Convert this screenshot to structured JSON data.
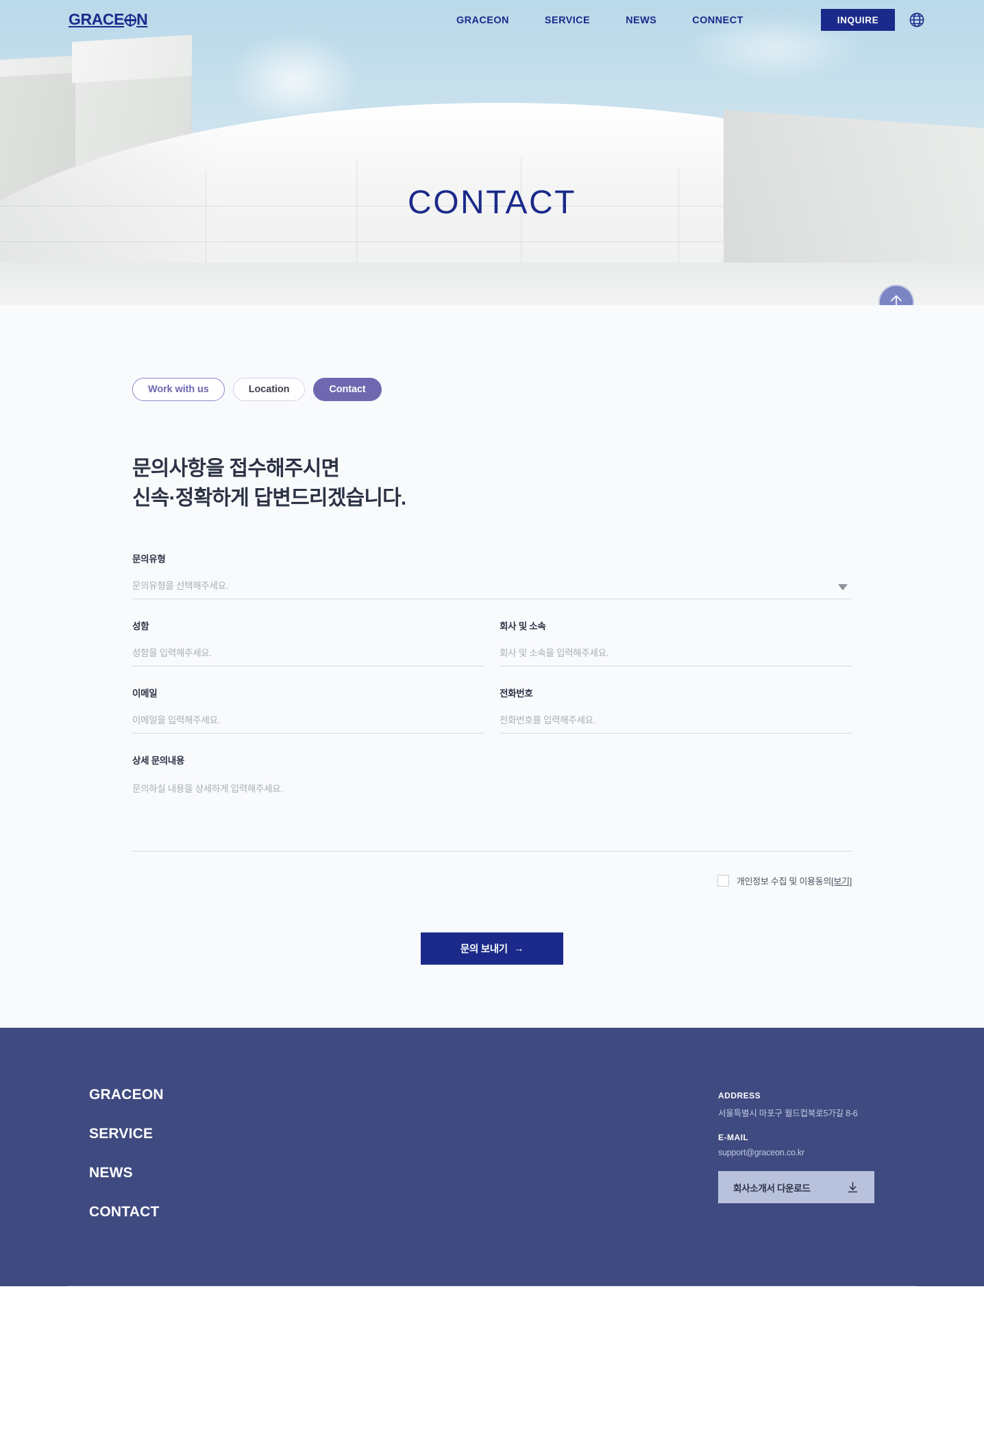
{
  "header": {
    "logo_text_before": "GRACE",
    "logo_icon": "globe-o-icon",
    "logo_text_after": "N",
    "nav": [
      {
        "label": "GRACEON"
      },
      {
        "label": "SERVICE"
      },
      {
        "label": "NEWS"
      },
      {
        "label": "CONNECT"
      }
    ],
    "inquire_label": "INQUIRE",
    "language_icon": "globe-icon"
  },
  "hero": {
    "title": "CONTACT",
    "title_color": "#1b2a8a"
  },
  "scroll_top": {
    "icon": "arrow-up-icon",
    "color": "#7b85c4"
  },
  "tabs": [
    {
      "label": "Work with us",
      "state": "outline-accent"
    },
    {
      "label": "Location",
      "state": "outline-muted"
    },
    {
      "label": "Contact",
      "state": "active"
    }
  ],
  "headline": {
    "line1": "문의사항을 접수해주시면",
    "line2": "신속·정확하게 답변드리겠습니다."
  },
  "form": {
    "inquiry_type": {
      "label": "문의유형",
      "placeholder": "문의유형을 선택해주세요.",
      "value": "",
      "caret_icon": "chevron-down-icon"
    },
    "name": {
      "label": "성함",
      "placeholder": "성함을 입력해주세요.",
      "value": ""
    },
    "company": {
      "label": "회사 및 소속",
      "placeholder": "회사 및 소속을 입력해주세요.",
      "value": ""
    },
    "email": {
      "label": "이메일",
      "placeholder": "이메일을 입력해주세요.",
      "value": ""
    },
    "phone": {
      "label": "전화번호",
      "placeholder": "전화번호를 입력해주세요.",
      "value": ""
    },
    "details": {
      "label": "상세 문의내용",
      "placeholder": "문의하실 내용을 상세하게 입력해주세요.",
      "value": ""
    },
    "consent": {
      "text": "개인정보 수집 및 이용동의",
      "view_link": "[보기]",
      "checked": false
    },
    "submit_label": "문의 보내기",
    "submit_arrow": "→",
    "submit_color": "#1b2a8a"
  },
  "footer": {
    "nav": [
      {
        "label": "GRACEON"
      },
      {
        "label": "SERVICE"
      },
      {
        "label": "NEWS"
      },
      {
        "label": "CONTACT"
      }
    ],
    "address_label": "ADDRESS",
    "address_value": "서울특별시 마포구 월드컵북로5가길 8-6",
    "email_label": "E-MAIL",
    "email_value": "support@graceon.co.kr",
    "download_label": "회사소개서 다운로드",
    "download_icon": "download-icon",
    "bg_color": "#3f4a80"
  }
}
